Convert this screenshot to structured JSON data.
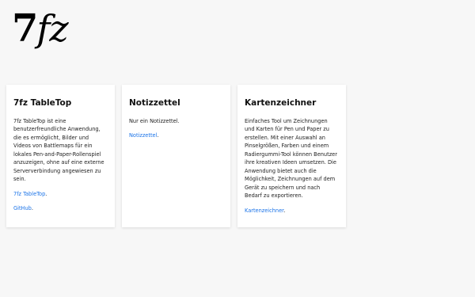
{
  "logo": {
    "part1": "7",
    "part2": "fz"
  },
  "cards": [
    {
      "title": "7fz TableTop",
      "description": "7fz TableTop ist eine benutzerfreundliche Anwendung, die es ermöglicht, Bilder und Videos von Battlemaps für ein lokales Pen-and-Paper-Rollenspiel anzuzeigen, ohne auf eine externe Serververbindung angewiesen zu sein.",
      "links": [
        {
          "text": "7fz TableTop",
          "suffix": "."
        },
        {
          "text": "GitHub",
          "suffix": "."
        }
      ]
    },
    {
      "title": "Notizzettel",
      "description": "Nur ein Notizzettel.",
      "links": [
        {
          "text": "Notizzettel",
          "suffix": "."
        }
      ]
    },
    {
      "title": "Kartenzeichner",
      "description": "Einfaches Tool um Zeichnungen und Karten für Pen und Paper zu erstellen. Mit einer Auswahl an Pinselgrößen, Farben und einem Radiergummi-Tool können Benutzer ihre kreativen Ideen umsetzen. Die Anwendung bietet auch die Möglichkeit, Zeichnungen auf dem Gerät zu speichern und nach Bedarf zu exportieren.",
      "links": [
        {
          "text": "Kartenzeichner",
          "suffix": "."
        }
      ]
    }
  ],
  "colors": {
    "background": "#f7f7f7",
    "card": "#ffffff",
    "link": "#1a73e8"
  }
}
